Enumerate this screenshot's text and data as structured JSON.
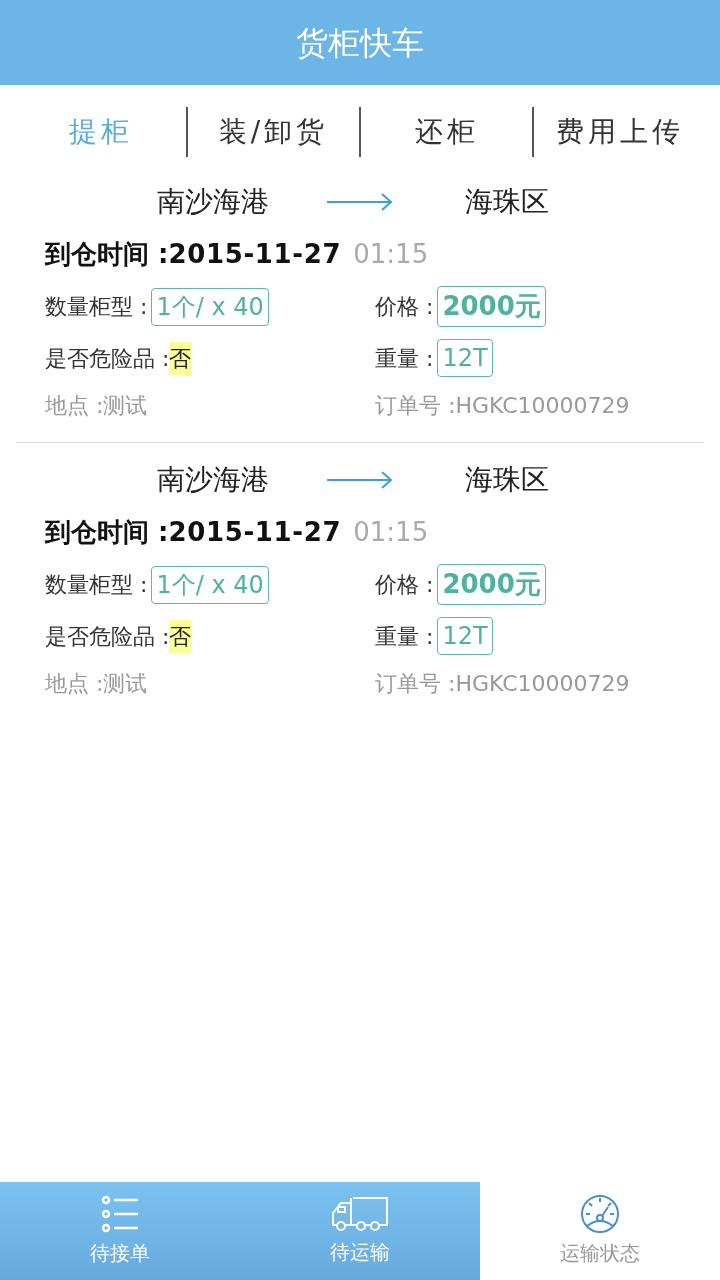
{
  "header": {
    "title": "货柜快车"
  },
  "tabs": [
    {
      "label": "提柜",
      "selected": true
    },
    {
      "label": "装/卸货",
      "selected": false
    },
    {
      "label": "还柜",
      "selected": false
    },
    {
      "label": "费用上传",
      "selected": false
    }
  ],
  "orders": [
    {
      "from": "南沙海港",
      "to": "海珠区",
      "arrival_label": "到仓时间 :",
      "arrival_date": "2015-11-27",
      "arrival_time": "01:15",
      "qty_label": "数量柜型 :",
      "qty": "1个/ x 40",
      "price_label": "价格 :",
      "price": "2000元",
      "danger_label": "是否危险品 :",
      "danger": "否",
      "weight_label": "重量 :",
      "weight": "12T",
      "place": "地点 :测试",
      "order_no": "订单号 :HGKC10000729"
    },
    {
      "from": "南沙海港",
      "to": "海珠区",
      "arrival_label": "到仓时间 :",
      "arrival_date": "2015-11-27",
      "arrival_time": "01:15",
      "qty_label": "数量柜型 :",
      "qty": "1个/ x 40",
      "price_label": "价格 :",
      "price": "2000元",
      "danger_label": "是否危险品 :",
      "danger": "否",
      "weight_label": "重量 :",
      "weight": "12T",
      "place": "地点 :测试",
      "order_no": "订单号 :HGKC10000729"
    }
  ],
  "bottom_nav": [
    {
      "label": "待接单",
      "kind": "list",
      "selected": false
    },
    {
      "label": "待运输",
      "kind": "truck",
      "selected": false
    },
    {
      "label": "运输状态",
      "kind": "gauge",
      "selected": true
    }
  ]
}
